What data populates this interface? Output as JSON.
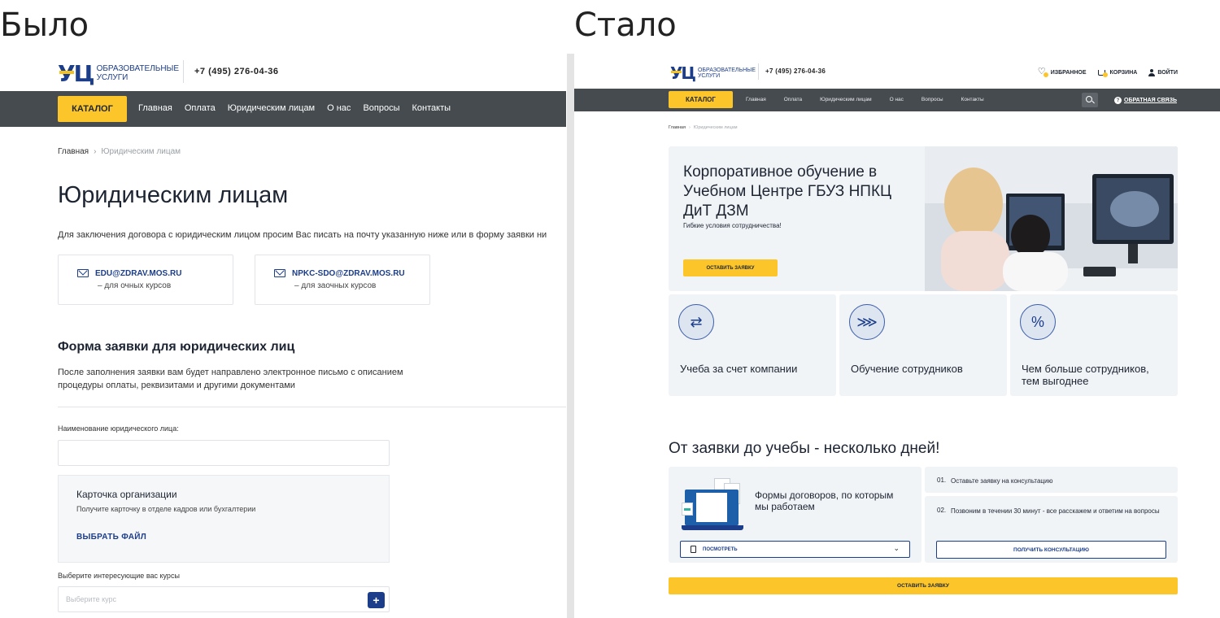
{
  "labels": {
    "before": "Было",
    "after": "Стало"
  },
  "brand": {
    "mark": "УЦ",
    "line1": "ОБРАЗОВАТЕЛЬНЫЕ",
    "line2": "УСЛУГИ",
    "phone": "+7 (495) 276-04-36"
  },
  "colors": {
    "accent_yellow": "#fcc62a",
    "nav_dark": "#464b4f",
    "brand_blue": "#1b3d8a"
  },
  "before": {
    "catalog_label": "КАТАЛОГ",
    "nav": [
      "Главная",
      "Оплата",
      "Юридическим лицам",
      "О нас",
      "Вопросы",
      "Контакты"
    ],
    "breadcrumb": {
      "home": "Главная",
      "sep": "›",
      "current": "Юридическим лицам"
    },
    "title": "Юридическим лицам",
    "intro": "Для заключения договора с юридическим лицом просим Вас писать на почту указанную ниже или в форму заявки ни",
    "emails": [
      {
        "address": "EDU@ZDRAV.MOS.RU",
        "desc": "– для очных курсов",
        "icon": "mail-icon"
      },
      {
        "address": "NPKC-SDO@ZDRAV.MOS.RU",
        "desc": "– для заочных курсов",
        "icon": "mail-icon"
      }
    ],
    "form_title": "Форма заявки для юридических лиц",
    "form_desc": "После заполнения заявки вам будет направлено электронное письмо с описанием процедуры оплаты, реквизитами и другими документами",
    "org_name_label": "Наименование юридического лица:",
    "org_card": {
      "title": "Карточка организации",
      "subtitle": "Получите карточку в отделе кадров или бухгалтерии",
      "file_label": "ВЫБРАТЬ ФАЙЛ"
    },
    "courses_label": "Выберите интересующие вас курсы",
    "courses_placeholder": "Выберите курс",
    "add_label": "+"
  },
  "after": {
    "user_links": {
      "favorites": "ИЗБРАННОЕ",
      "cart": "КОРЗИНА",
      "login": "ВОЙТИ"
    },
    "catalog_label": "КАТАЛОГ",
    "nav": [
      "Главная",
      "Оплата",
      "Юридическим лицам",
      "О нас",
      "Вопросы",
      "Контакты"
    ],
    "feedback_label": "ОБРАТНАЯ СВЯЗЬ",
    "feedback_icon_glyph": "?",
    "breadcrumb": {
      "home": "Главная",
      "sep": "›",
      "current": "Юридическим лицам"
    },
    "hero": {
      "title": "Корпоративное обучение в Учебном Центре ГБУЗ НПКЦ ДиТ ДЗМ",
      "subtitle": "Гибкие условия сотрудничества!",
      "button": "ОСТАВИТЬ ЗАЯВКУ"
    },
    "benefits": [
      {
        "text": "Учеба за счет компании",
        "icon": "checklist-icon",
        "glyph": "⇄"
      },
      {
        "text": "Обучение сотрудников",
        "icon": "fast-forward-icon",
        "glyph": "⋙"
      },
      {
        "text": "Чем больше сотрудников, тем выгоднее",
        "icon": "percent-icon",
        "glyph": "%"
      }
    ],
    "steps_title": "От заявки до учебы - несколько дней!",
    "forms_card": {
      "title": "Формы договоров, по которым мы работаем",
      "select_label": "ПОСМОТРЕТЬ",
      "chevron": "⌄"
    },
    "steps": [
      {
        "num": "01.",
        "text": "Оставьте заявку на консультацию"
      },
      {
        "num": "02.",
        "text": "Позвоним в течении 30 минут - все расскажем и ответим на вопросы"
      }
    ],
    "consult_button": "ПОЛУЧИТЬ КОНСУЛЬТАЦИЮ",
    "main_button": "ОСТАВИТЬ ЗАЯВКУ"
  }
}
